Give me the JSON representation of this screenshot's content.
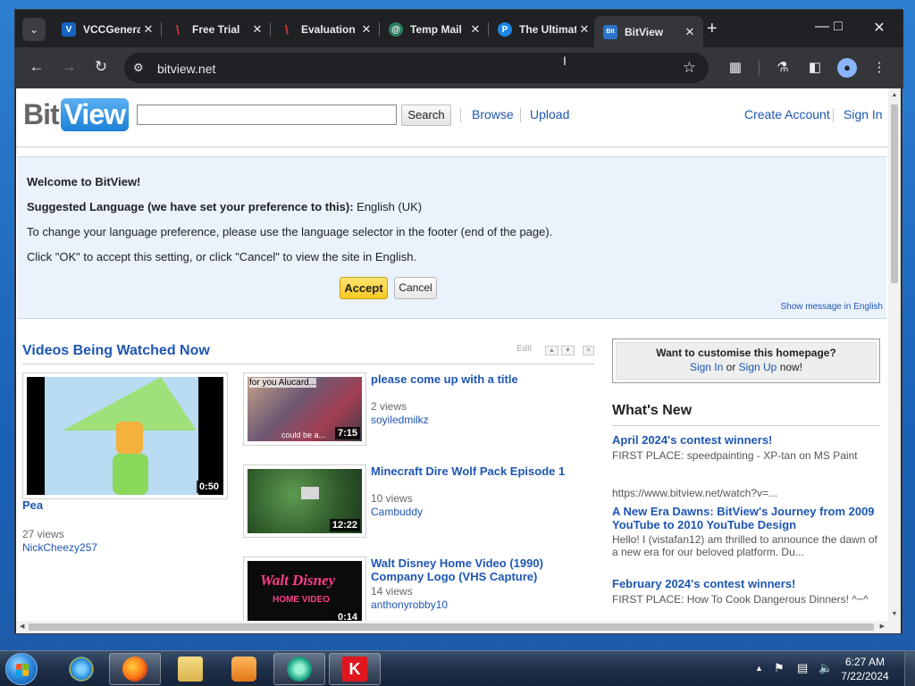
{
  "browser": {
    "tabs": [
      {
        "label": "VCCGenerator",
        "icon_color": "#1565c0",
        "icon_text": "V"
      },
      {
        "label": "Free Trial",
        "icon_color": "#c62828",
        "icon_text": "\\"
      },
      {
        "label": "Evaluation",
        "icon_color": "#c62828",
        "icon_text": "\\"
      },
      {
        "label": "Temp Mail",
        "icon_color": "#2e7d64",
        "icon_text": "@"
      },
      {
        "label": "The Ultimate",
        "icon_color": "#1e88e5",
        "icon_text": "P"
      },
      {
        "label": "BitView",
        "icon_color": "#2a73c9",
        "icon_text": "Bit"
      }
    ],
    "url": "bitview.net"
  },
  "site": {
    "logo_bit": "Bit",
    "logo_view": "View",
    "search_value": "",
    "search_button": "Search",
    "nav": {
      "browse": "Browse",
      "upload": "Upload",
      "create_account": "Create Account",
      "sign_in": "Sign In"
    }
  },
  "welcome": {
    "heading": "Welcome to BitView!",
    "suggested_label": "Suggested Language (we have set your preference to this):",
    "suggested_value": "English (UK)",
    "change_text": "To change your language preference, please use the language selector in the footer (end of the page).",
    "ok_text": "Click \"OK\" to accept this setting, or click \"Cancel\" to view the site in English.",
    "accept": "Accept",
    "cancel": "Cancel",
    "show_english": "Show message in English"
  },
  "videos_section": {
    "title": "Videos Being Watched Now",
    "edit": "Edit",
    "featured": {
      "title": "Pea",
      "duration": "0:50",
      "views": "27 views",
      "user": "NickCheezy257"
    },
    "list": [
      {
        "title": "please come up with a title",
        "duration": "7:15",
        "views": "2 views",
        "user": "soyiledmilkz",
        "thumb_text": "for you Alucard...",
        "thumb_caption": "could be a..."
      },
      {
        "title": "Minecraft Dire Wolf Pack Episode 1",
        "duration": "12:22",
        "views": "10 views",
        "user": "Cambuddy"
      },
      {
        "title": "Walt Disney Home Video (1990) Company Logo (VHS Capture)",
        "duration": "0:14",
        "views": "14 views",
        "user": "anthonyrobby10",
        "thumb_text": "Walt Disney",
        "thumb_caption": "HOME VIDEO"
      }
    ]
  },
  "customise": {
    "question": "Want to customise this homepage?",
    "sign_in": "Sign In",
    "or": " or ",
    "sign_up": "Sign Up",
    "now": " now!"
  },
  "whats_new": {
    "title": "What's New",
    "items": [
      {
        "title": "April 2024's contest winners!",
        "text": "FIRST PLACE: speedpainting - XP-tan on MS Paint"
      },
      {
        "title": "",
        "text": "https://www.bitview.net/watch?v=..."
      },
      {
        "title": "A New Era Dawns: BitView's Journey from 2009 YouTube to 2010 YouTube Design",
        "text": "Hello! I (vistafan12) am thrilled to announce the dawn of a new era for our beloved platform. Du..."
      },
      {
        "title": "February 2024's contest winners!",
        "text": "FIRST PLACE: How To Cook Dangerous Dinners! ^~^"
      }
    ]
  },
  "taskbar": {
    "time": "6:27 AM",
    "date": "7/22/2024"
  },
  "colors": {
    "link": "#1e56b3",
    "accept": "#f7c920",
    "banner": "#eaf2fc"
  }
}
